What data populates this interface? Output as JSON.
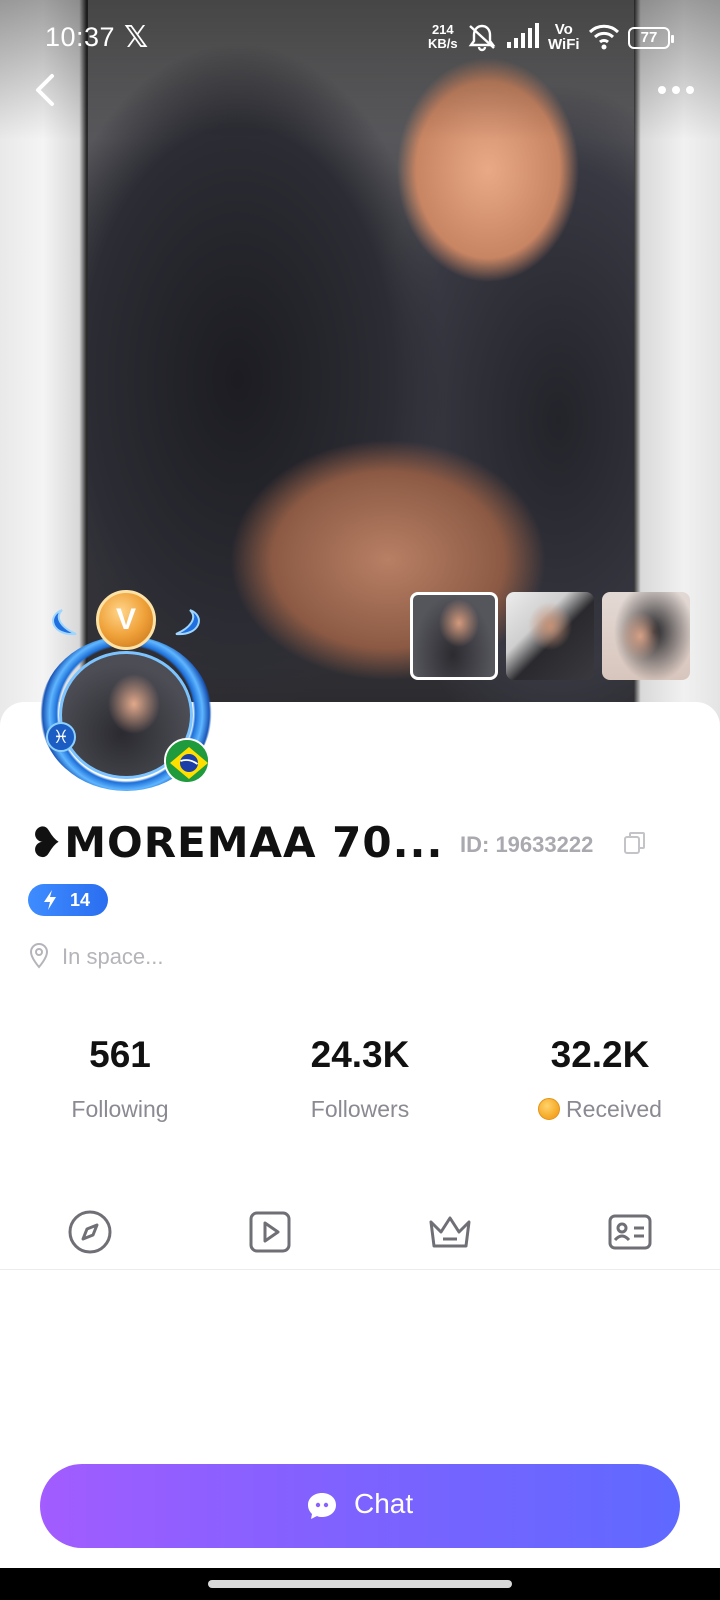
{
  "status_bar": {
    "time": "10:37",
    "x_icon": "x-logo-icon",
    "net_speed_value": "214",
    "net_speed_unit": "KB/s",
    "vowifi_top": "Vo",
    "vowifi_bottom": "WiFi",
    "battery": "77"
  },
  "nav": {
    "back_icon": "chevron-left-icon",
    "more_icon": "more-horizontal-icon"
  },
  "gallery": {
    "thumbnails": [
      "photo-1",
      "photo-2",
      "photo-3"
    ],
    "active_index": 0
  },
  "profile": {
    "vip_letter": "V",
    "username": "❥MOREMAA 70...",
    "id_label": "ID: 19633222",
    "level": "14",
    "location": "In space...",
    "flag": "brazil-flag"
  },
  "stats": [
    {
      "value": "561",
      "label": "Following"
    },
    {
      "value": "24.3K",
      "label": "Followers"
    },
    {
      "value": "32.2K",
      "label": "Received"
    }
  ],
  "tabs": [
    "compass-icon",
    "video-icon",
    "crown-icon",
    "profile-card-icon"
  ],
  "chat_button": {
    "label": "Chat"
  },
  "colors": {
    "accent_start": "#a25cff",
    "accent_end": "#5f69ff",
    "level_badge": "#3e8cff",
    "coin": "#f5a623"
  }
}
